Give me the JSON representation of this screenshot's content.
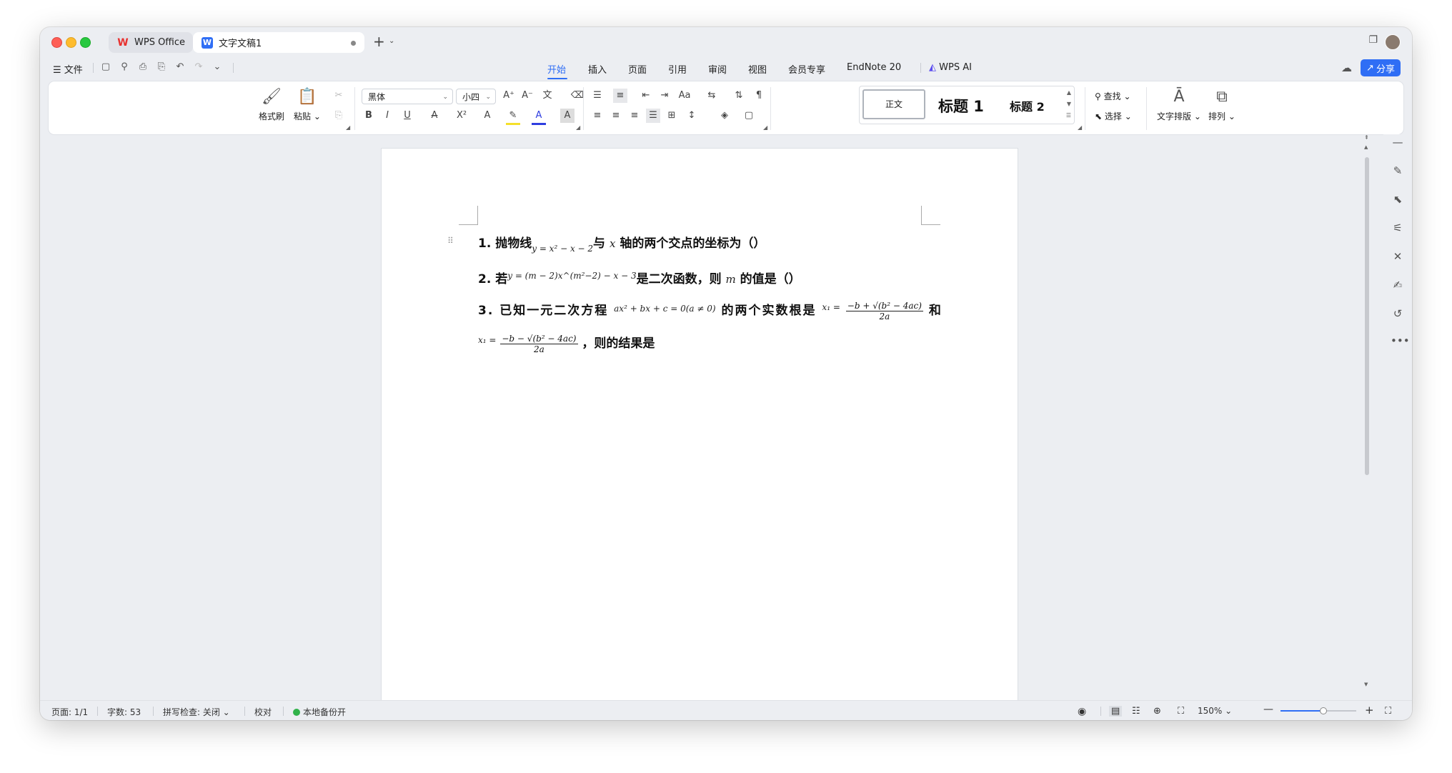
{
  "titlebar": {
    "tab1_label": "WPS Office",
    "tab2_label": "文字文稿1"
  },
  "menubar": {
    "file_label": "文件",
    "tabs": [
      "开始",
      "插入",
      "页面",
      "引用",
      "审阅",
      "视图",
      "会员专享",
      "EndNote 20"
    ],
    "active_tab": "开始",
    "wps_ai_label": "WPS AI",
    "share_label": "分享"
  },
  "ribbon": {
    "format_painter": "格式刷",
    "paste": "粘贴",
    "font_name": "黑体",
    "font_size": "小四",
    "styles": {
      "normal": "正文",
      "heading1": "标题 1",
      "heading2": "标题 2"
    },
    "find": "查找",
    "select": "选择",
    "text_layout": "文字排版",
    "arrange": "排列"
  },
  "document": {
    "q1_num": "1.",
    "q1_a": "抛物线",
    "q1_formula": "y = x² − x − 2",
    "q1_b": "与",
    "q1_var": "x",
    "q1_c": "轴的两个交点的坐标为（）",
    "q2_num": "2.",
    "q2_a": "若",
    "q2_formula": "y = (m − 2)x^(m²−2) − x − 3",
    "q2_b": "是二次函数，则",
    "q2_var": "m",
    "q2_c": "的值是（）",
    "q3_num": "3.",
    "q3_a": "已知一元二次方程",
    "q3_formula": "ax² + bx + c = 0(a ≠ 0)",
    "q3_b": "的两个实数根是",
    "q3_x1_lhs": "x₁ =",
    "q3_x1_num": "−b + √(b² − 4ac)",
    "q3_den": "2a",
    "q3_and": "和",
    "q3_x2_lhs": "x₁ =",
    "q3_x2_num": "−b − √(b² − 4ac)",
    "q3_end": "，则的结果是"
  },
  "statusbar": {
    "page": "页面: 1/1",
    "words": "字数: 53",
    "spell": "拼写检查: 关闭",
    "proof": "校对",
    "backup": "本地备份开",
    "zoom": "150%",
    "zoom_level_percent": 150
  },
  "colors": {
    "accent": "#2f6ef5",
    "close": "#fe5f57",
    "minimize": "#febc2e",
    "maximize": "#28c840"
  }
}
